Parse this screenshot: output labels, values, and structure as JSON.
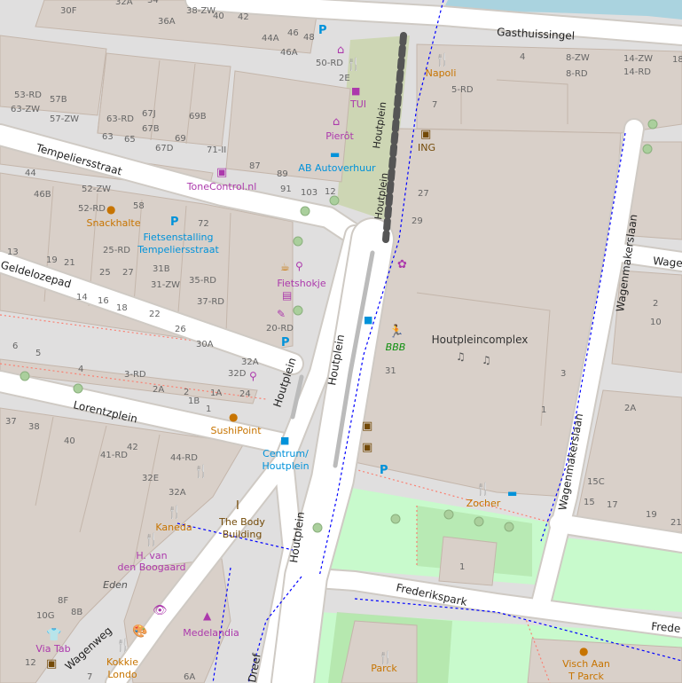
{
  "streets": {
    "gasthuissingel": "Gasthuissingel",
    "tempeliersstraat": "Tempeliersstraat",
    "geldelozepad": "Geldelozepad",
    "lorentzplein": "Lorentzplein",
    "houtplein_a": "Houtplein",
    "houtplein_b": "Houtplein",
    "houtplein_c": "Houtplein",
    "houtplein_d": "Houtplein",
    "houtplein_e": "Houtplein",
    "houtplein_f": "Houtplein",
    "wagenmakerslaan_a": "Wagenmakerslaan",
    "wagenmakerslaan_b": "Wagenmakerslaan",
    "wage": "Wage",
    "frederikspark": "Frederikspark",
    "frede": "Frede",
    "wagenweg": "Wagenweg",
    "dreef": "Dreef"
  },
  "pois": {
    "napoli": "Napoli",
    "tui": "TUI",
    "pierot": "Pierôt",
    "ing": "ING",
    "ab_autoverhuur": "AB Autoverhuur",
    "tonecontrol": "ToneControl.nl",
    "snackhalte": "Snackhalte",
    "fietsenstalling_1": "Fietsenstalling",
    "fietsenstalling_2": "Tempeliersstraat",
    "fietshokje": "Fietshokje",
    "houtpleincomplex": "Houtpleincomplex",
    "bbb": "BBB",
    "sushipoint": "SushiPoint",
    "centrum_1": "Centrum/",
    "centrum_2": "Houtplein",
    "zocher": "Zocher",
    "kaneda": "Kaneda",
    "body_1": "The Body",
    "body_2": "Building",
    "hvan_1": "H. van",
    "hvan_2": "den Boogaard",
    "eden": "Eden",
    "medelandia": "Medelandia",
    "viatab": "Via Tab",
    "kokkie_1": "Kokkie",
    "kokkie_2": "Londo",
    "parck": "Parck",
    "visch_1": "Visch Aan",
    "visch_2": "T Parck"
  },
  "housenumbers": [
    "30F",
    "32A",
    "34",
    "36A",
    "38-ZW",
    "40",
    "42",
    "44A",
    "46",
    "48",
    "46A",
    "50-RD",
    "2E",
    "53-RD",
    "57B",
    "63-ZW",
    "57-ZW",
    "63-RD",
    "67J",
    "69B",
    "63",
    "65",
    "67B",
    "67D",
    "69",
    "71-II",
    "87",
    "89",
    "91",
    "103",
    "12",
    "44",
    "46B",
    "52-ZW",
    "58",
    "52-RD",
    "72",
    "13",
    "19",
    "21",
    "25-RD",
    "25",
    "27",
    "31B",
    "31-ZW",
    "35-RD",
    "14",
    "16",
    "18",
    "22",
    "37-RD",
    "26",
    "20-RD",
    "30A",
    "6",
    "5",
    "4",
    "3-RD",
    "32A",
    "32D",
    "2A",
    "2",
    "1B",
    "1A",
    "24",
    "1",
    "37",
    "38",
    "40",
    "41-RD",
    "42",
    "44-RD",
    "32E",
    "32A",
    "10G",
    "8F",
    "8B",
    "12",
    "7",
    "6A",
    "4",
    "8-ZW",
    "14-ZW",
    "8-RD",
    "14-RD",
    "18",
    "5-RD",
    "7",
    "27",
    "29",
    "31",
    "3",
    "1",
    "2",
    "10",
    "2A",
    "15C",
    "15",
    "17",
    "19",
    "21",
    "1"
  ],
  "colors": {
    "background": "#f2efe9",
    "building": "#d9d0c9",
    "building_stroke": "#c4b6ab",
    "road": "#ffffff",
    "road_casing": "#cfcac4",
    "park": "#c8facc",
    "water": "#aad3df",
    "footway": "#fa8072",
    "cycleway": "#0000ff",
    "food": "#c77400",
    "shop": "#ac39ac",
    "transport": "#0092da",
    "leisure": "#0e8f0e",
    "amenity": "#734a08",
    "label": "#333333"
  },
  "icons": [
    "bicycle-parking-icon",
    "restaurant-icon",
    "cafe-icon",
    "fast-food-icon",
    "bank-icon",
    "bus-stop-icon",
    "shop-icon",
    "car-rental-icon",
    "fitness-icon",
    "bicycle-shop-icon",
    "hostel-icon",
    "monument-icon",
    "florist-icon"
  ]
}
